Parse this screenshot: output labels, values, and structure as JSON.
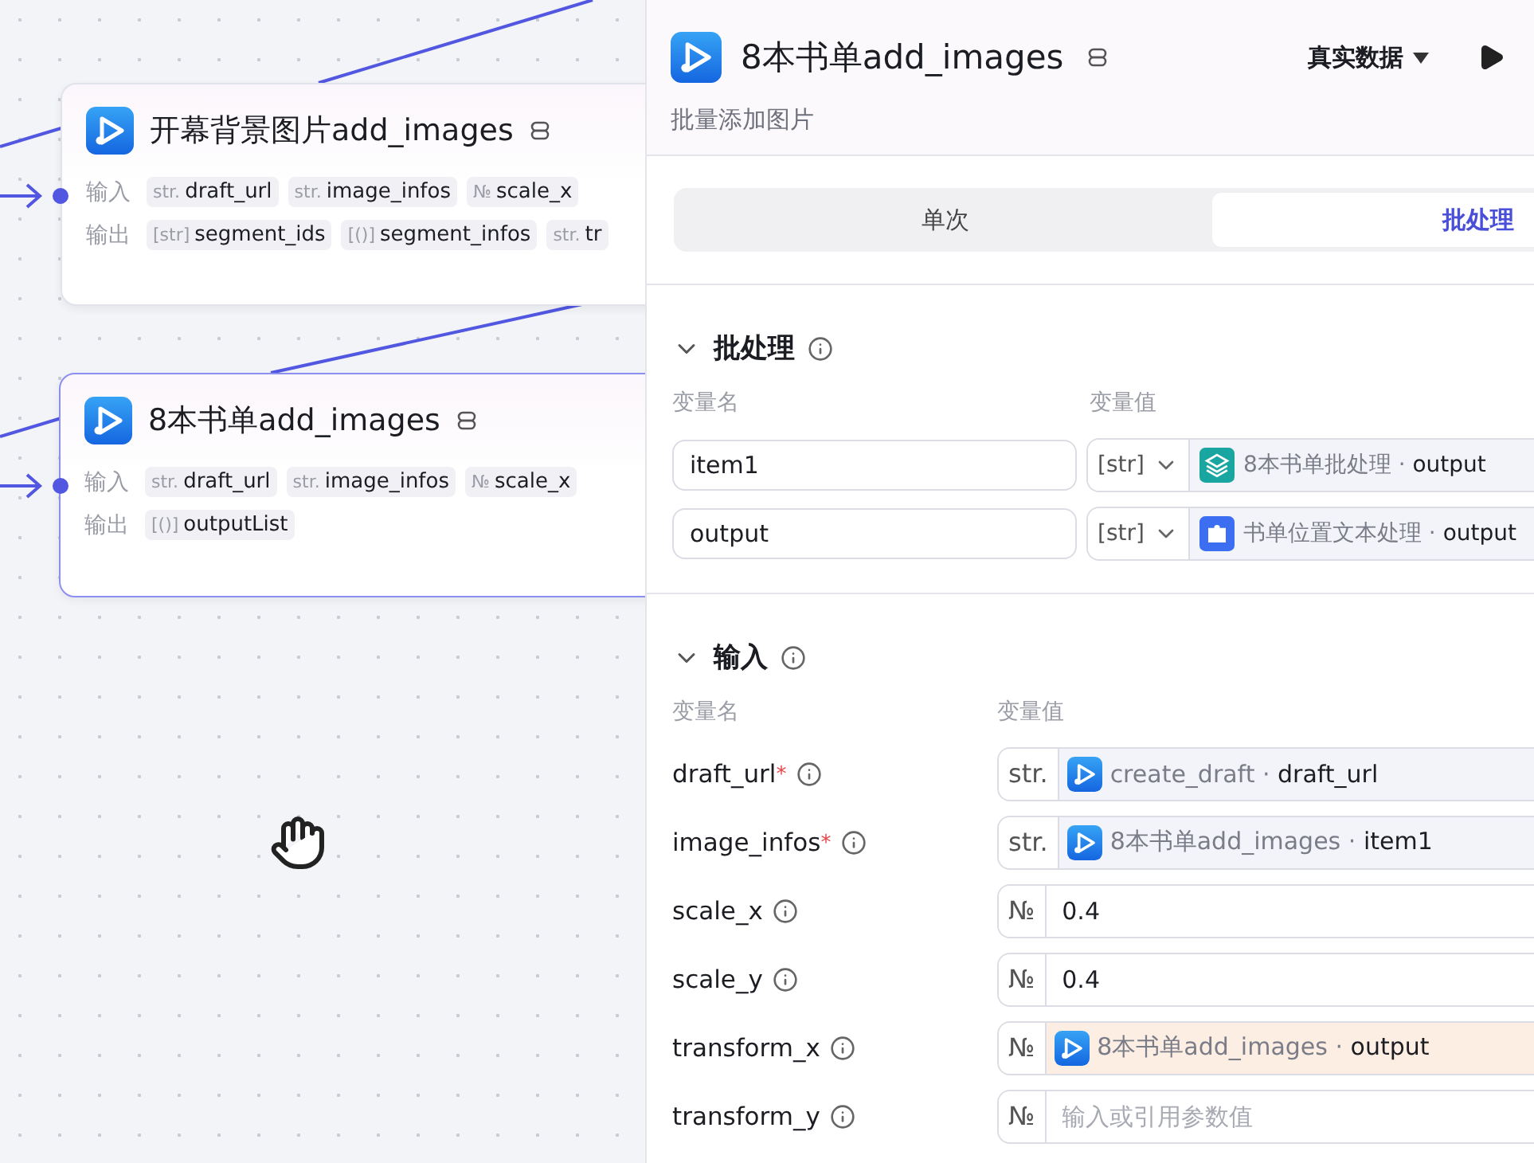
{
  "canvas": {
    "nodes": [
      {
        "title": "开幕背景图片add_images",
        "selected": false,
        "input_label": "输入",
        "output_label": "输出",
        "inputs": [
          {
            "type": "str.",
            "name": "draft_url"
          },
          {
            "type": "str.",
            "name": "image_infos"
          },
          {
            "type": "№",
            "name": "scale_x"
          }
        ],
        "outputs": [
          {
            "type": "[str]",
            "name": "segment_ids"
          },
          {
            "type": "[()]",
            "name": "segment_infos"
          },
          {
            "type": "str.",
            "name": "tr"
          }
        ]
      },
      {
        "title": "8本书单add_images",
        "selected": true,
        "input_label": "输入",
        "output_label": "输出",
        "inputs": [
          {
            "type": "str.",
            "name": "draft_url"
          },
          {
            "type": "str.",
            "name": "image_infos"
          },
          {
            "type": "№",
            "name": "scale_x"
          }
        ],
        "outputs": [
          {
            "type": "[()]",
            "name": "outputList"
          }
        ]
      }
    ]
  },
  "panel": {
    "title": "8本书单add_images",
    "data_mode": "真实数据",
    "description": "批量添加图片",
    "tabs": [
      {
        "label": "单次",
        "selected": false
      },
      {
        "label": "批处理",
        "selected": true
      }
    ],
    "batch": {
      "title": "批处理",
      "expanded": true,
      "name_header": "变量名",
      "value_header": "变量值",
      "rows": [
        {
          "name": "item1",
          "type": "[str]",
          "kind": "batch_ref",
          "ref": "8本书单批处理 · **output**"
        },
        {
          "name": "output",
          "type": "[str]",
          "kind": "text_ref",
          "ref": "书单位置文本处理 · **output**"
        }
      ]
    },
    "inputs": {
      "title": "输入",
      "expanded": true,
      "name_header": "变量名",
      "value_header": "变量值",
      "rows": [
        {
          "name": "draft_url",
          "required_mark": "*",
          "type": "str.",
          "kind": "plugin_ref",
          "ref": "create_draft · **draft_url**",
          "highlighted": false
        },
        {
          "name": "image_infos",
          "required_mark": "*",
          "type": "str.",
          "kind": "plugin_ref",
          "ref": "8本书单add_images · **item1**",
          "highlighted": false
        },
        {
          "name": "scale_x",
          "type": "№",
          "kind": "value",
          "value": "0.4",
          "highlighted": false
        },
        {
          "name": "scale_y",
          "type": "№",
          "kind": "value",
          "value": "0.4",
          "highlighted": false
        },
        {
          "name": "transform_x",
          "type": "№",
          "kind": "plugin_ref",
          "ref": "8本书单add_images · **output**",
          "highlighted": true
        },
        {
          "name": "transform_y",
          "type": "№",
          "kind": "placeholder",
          "placeholder": "输入或引用参数值",
          "highlighted": false
        }
      ]
    }
  }
}
